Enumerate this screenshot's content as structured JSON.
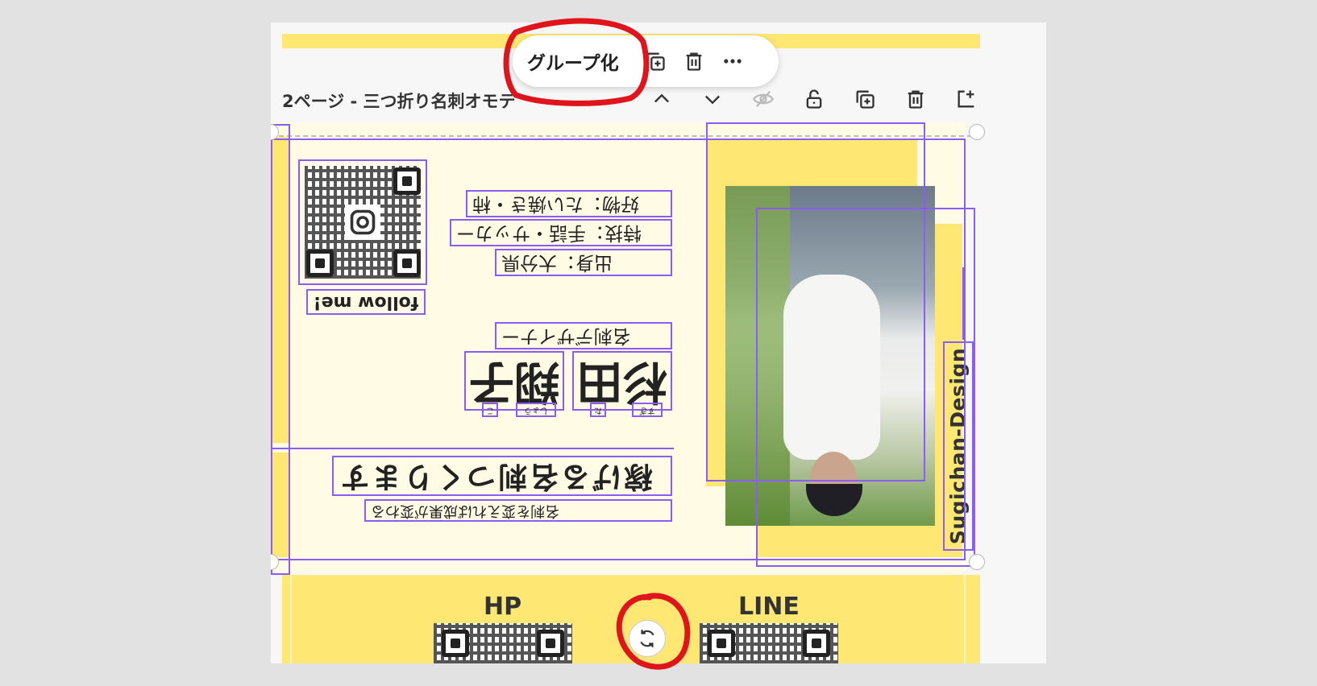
{
  "toolbar": {
    "group_label": "グループ化",
    "copy_icon": "copy-plus-icon",
    "delete_icon": "trash-icon",
    "more_icon": "more-horizontal-icon"
  },
  "page_header": {
    "title": "2ページ - 三つ折り名刺オモテ",
    "icons": [
      "chevron-up-icon",
      "chevron-down-icon",
      "eye-off-icon",
      "unlock-icon",
      "duplicate-icon",
      "trash-icon",
      "add-page-icon"
    ]
  },
  "card": {
    "follow_text": "follow me!",
    "hobby": "好物：たい焼き・柿",
    "skill": "特技：手話・サッカー",
    "origin": "出身：大分県",
    "job_title": "名刺デザイナー",
    "surname": "杉田",
    "given_name": "翔子",
    "surname_ruby_1": "すぎ",
    "surname_ruby_2": "た",
    "given_ruby_1": "しょう",
    "given_ruby_2": "こ",
    "catchphrase": "稼げる名刺つくります",
    "tagline": "名刺を変えれば成果が変わる",
    "brand": "Sugichan-Design"
  },
  "bottom_panel": {
    "hp_label": "HP",
    "line_label": "LINE",
    "rotate_icon": "rotate-icon"
  },
  "colors": {
    "accent_yellow": "#ffe773",
    "cream": "#fffbe4",
    "selection_purple": "#8b5cf6",
    "annotation_red": "#e0141b"
  }
}
